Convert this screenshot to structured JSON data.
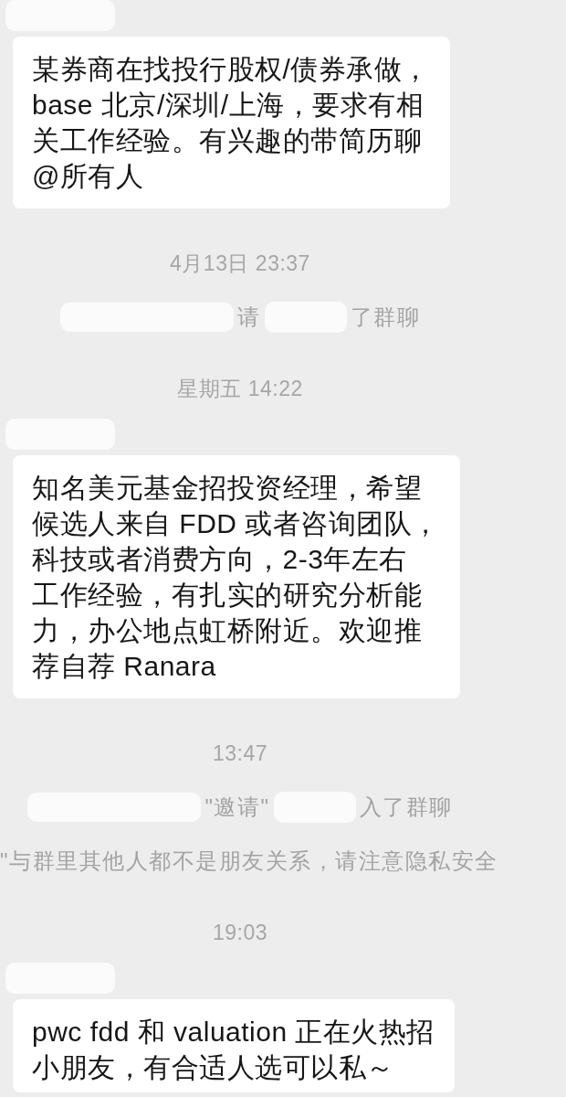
{
  "chat": [
    {
      "kind": "message",
      "sender_redacted": true,
      "lines": [
        "某券商在找投行股权/债券承做，",
        "base 北京/深圳/上海，要求有相",
        "关工作经验。有兴趣的带简历聊",
        "@所有人"
      ]
    },
    {
      "kind": "time",
      "text": "4月13日 23:37"
    },
    {
      "kind": "system",
      "segments": [
        {
          "kind": "redacted"
        },
        {
          "kind": "text",
          "text": "请"
        },
        {
          "kind": "redacted"
        },
        {
          "kind": "text",
          "text": "了群聊"
        }
      ]
    },
    {
      "kind": "time",
      "text": "星期五 14:22"
    },
    {
      "kind": "message",
      "sender_redacted": true,
      "lines": [
        "知名美元基金招投资经理，希望",
        "候选人来自 FDD 或者咨询团队，",
        "科技或者消费方向，2-3年左右",
        "工作经验，有扎实的研究分析能",
        "力，办公地点虹桥附近。欢迎推",
        "荐自荐 Ranara"
      ]
    },
    {
      "kind": "time",
      "text": "13:47"
    },
    {
      "kind": "system",
      "segments": [
        {
          "kind": "redacted"
        },
        {
          "kind": "text",
          "text": "\"邀请\""
        },
        {
          "kind": "redacted"
        },
        {
          "kind": "text",
          "text": "入了群聊"
        }
      ]
    },
    {
      "kind": "system",
      "segments": [
        {
          "kind": "text",
          "text": "\"与群里其他人都不是朋友关系，请注意隐私安全"
        }
      ]
    },
    {
      "kind": "time",
      "text": "19:03"
    },
    {
      "kind": "message",
      "sender_redacted": true,
      "lines": [
        "pwc fdd 和 valuation 正在火热招",
        "小朋友，有合适人选可以私～"
      ]
    }
  ]
}
